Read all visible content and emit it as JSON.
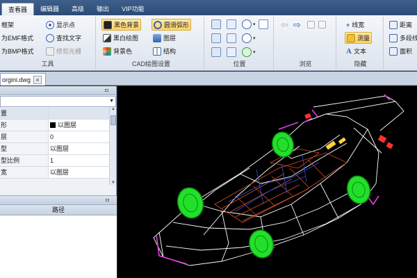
{
  "tabs": [
    {
      "label": "查看器",
      "active": true
    },
    {
      "label": "编辑器",
      "active": false
    },
    {
      "label": "高级",
      "active": false
    },
    {
      "label": "输出",
      "active": false
    },
    {
      "label": "VIP功能",
      "active": false
    }
  ],
  "ribbon": {
    "tools": {
      "title": "工具",
      "items": [
        "框架",
        "为EMF格式",
        "为BMP格式",
        "显示点",
        "查找文字",
        "修剪光栅"
      ]
    },
    "cad": {
      "title": "CAD绘图设置",
      "items": [
        "黑色背景",
        "黑白绘图",
        "背景色",
        "圆滑弧形",
        "图层",
        "结构"
      ]
    },
    "position": {
      "title": "位置"
    },
    "browse": {
      "title": "浏览"
    },
    "hide": {
      "title": "隐藏",
      "items": [
        "线宽",
        "测量",
        "文本"
      ]
    },
    "measure": {
      "items": [
        "距离",
        "多段线",
        "面积"
      ]
    }
  },
  "document": {
    "tab": "orgini.dwg",
    "close": "×"
  },
  "panel": {
    "pin": "ㅁ",
    "rows": [
      {
        "key": "置",
        "value": ""
      },
      {
        "key": "形",
        "value": "以图层",
        "swatch": "#000000"
      },
      {
        "key": "层",
        "value": "0"
      },
      {
        "key": "型",
        "value": "以图层"
      },
      {
        "key": "型比例",
        "value": "1"
      },
      {
        "key": "宽",
        "value": "以图层"
      }
    ],
    "path_header": "路径"
  },
  "colors": {
    "accent_tab": "#2b4a74",
    "highlight": "#ffd36a",
    "canvas": "#000000"
  }
}
